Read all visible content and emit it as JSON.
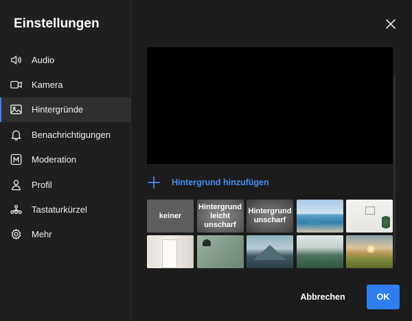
{
  "dialog": {
    "title": "Einstellungen"
  },
  "sidebar": {
    "items": [
      {
        "label": "Audio",
        "icon": "speaker-icon"
      },
      {
        "label": "Kamera",
        "icon": "camera-icon"
      },
      {
        "label": "Hintergründe",
        "icon": "image-icon",
        "active": true
      },
      {
        "label": "Benachrichtigungen",
        "icon": "bell-icon"
      },
      {
        "label": "Moderation",
        "icon": "moderation-icon"
      },
      {
        "label": "Profil",
        "icon": "person-icon"
      },
      {
        "label": "Tastaturkürzel",
        "icon": "shortcuts-icon"
      },
      {
        "label": "Mehr",
        "icon": "gear-icon"
      }
    ]
  },
  "main": {
    "add_background_label": "Hintergrund hinzufügen",
    "backgrounds": [
      {
        "label": "keiner"
      },
      {
        "label": "Hintergrund leicht unscharf"
      },
      {
        "label": "Hintergrund unscharf"
      },
      {
        "label": ""
      },
      {
        "label": ""
      },
      {
        "label": ""
      },
      {
        "label": ""
      },
      {
        "label": ""
      },
      {
        "label": ""
      },
      {
        "label": ""
      }
    ]
  },
  "footer": {
    "cancel_label": "Abbrechen",
    "ok_label": "OK"
  },
  "colors": {
    "accent": "#2f7ef0",
    "link": "#4a8df0",
    "sidebar_bg": "#1f1f1f",
    "active_item_bg": "#2f2f2f"
  }
}
